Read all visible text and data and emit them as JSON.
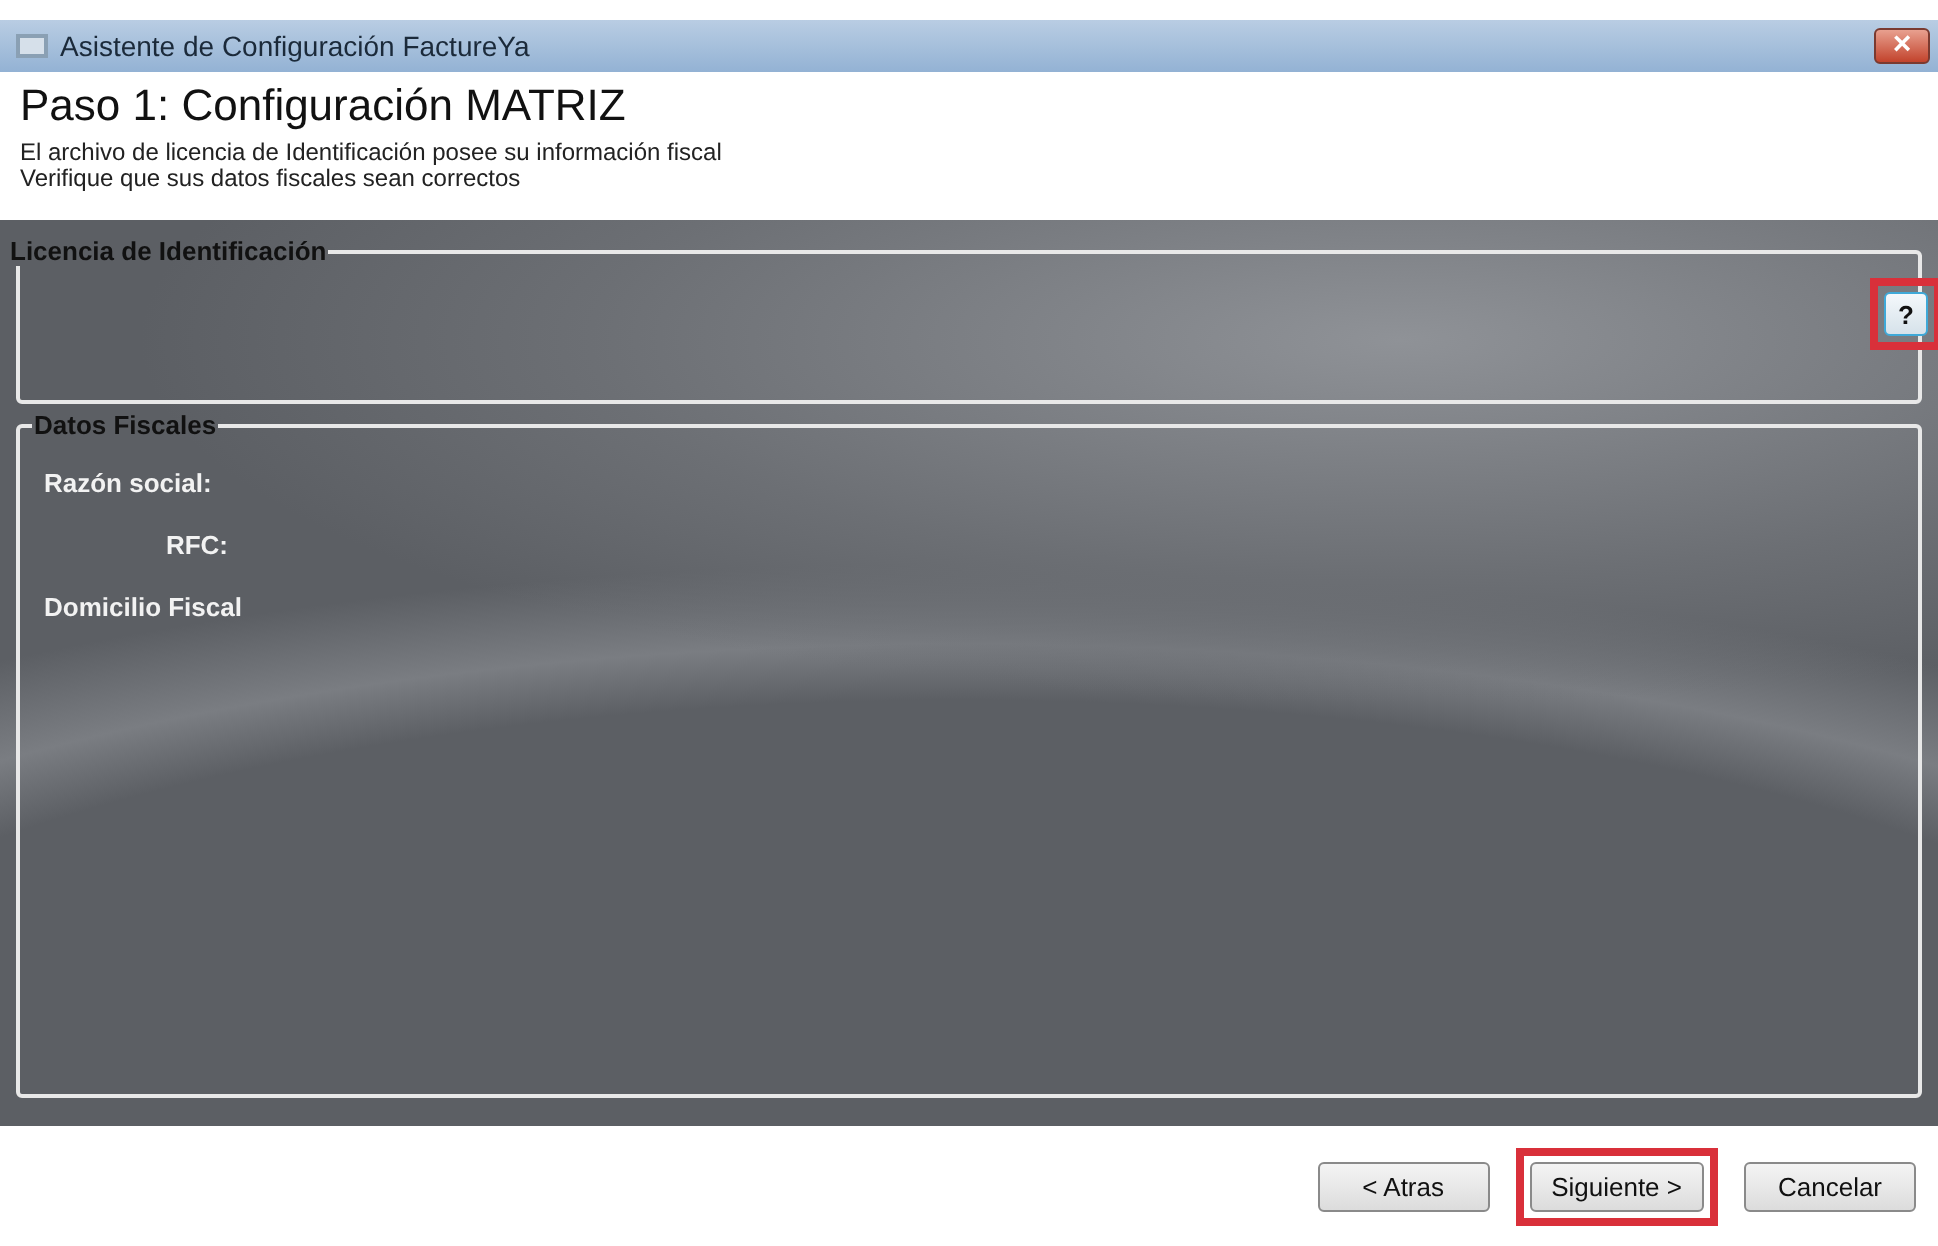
{
  "window": {
    "title": "Asistente de Configuración FactureYa",
    "close": "×"
  },
  "header": {
    "title": "Paso 1: Configuración MATRIZ",
    "lines": [
      "El archivo de licencia de Identificación posee su información fiscal",
      "Verifique que sus datos fiscales sean correctos"
    ]
  },
  "license_group": {
    "title": "Licencia de Identificación",
    "help_button": {
      "label": "?",
      "highlighted": true
    }
  },
  "fiscal_group": {
    "title": "Datos Fiscales",
    "fields": [
      {
        "label": "Razón social:",
        "kind": "label"
      },
      {
        "label": "RFC:",
        "kind": "short-label"
      },
      {
        "label": "Domicilio Fiscal",
        "kind": "label"
      }
    ]
  },
  "buttons": [
    {
      "label": "< Atras",
      "highlighted": false
    },
    {
      "label": "Siguiente >",
      "highlighted": true
    },
    {
      "label": "Cancelar",
      "highlighted": false
    }
  ]
}
